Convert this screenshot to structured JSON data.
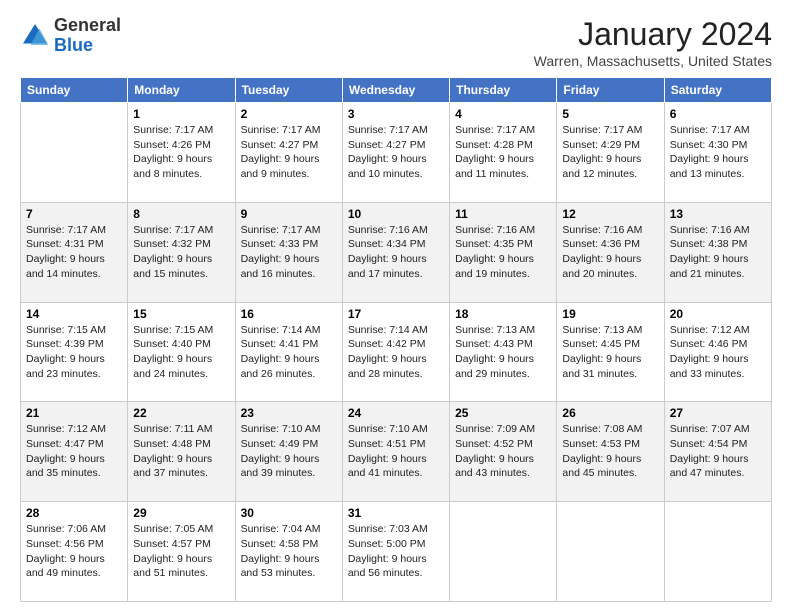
{
  "header": {
    "logo_general": "General",
    "logo_blue": "Blue",
    "month_title": "January 2024",
    "location": "Warren, Massachusetts, United States"
  },
  "weekdays": [
    "Sunday",
    "Monday",
    "Tuesday",
    "Wednesday",
    "Thursday",
    "Friday",
    "Saturday"
  ],
  "weeks": [
    [
      {
        "day": "",
        "sunrise": "",
        "sunset": "",
        "daylight": ""
      },
      {
        "day": "1",
        "sunrise": "Sunrise: 7:17 AM",
        "sunset": "Sunset: 4:26 PM",
        "daylight": "Daylight: 9 hours and 8 minutes."
      },
      {
        "day": "2",
        "sunrise": "Sunrise: 7:17 AM",
        "sunset": "Sunset: 4:27 PM",
        "daylight": "Daylight: 9 hours and 9 minutes."
      },
      {
        "day": "3",
        "sunrise": "Sunrise: 7:17 AM",
        "sunset": "Sunset: 4:27 PM",
        "daylight": "Daylight: 9 hours and 10 minutes."
      },
      {
        "day": "4",
        "sunrise": "Sunrise: 7:17 AM",
        "sunset": "Sunset: 4:28 PM",
        "daylight": "Daylight: 9 hours and 11 minutes."
      },
      {
        "day": "5",
        "sunrise": "Sunrise: 7:17 AM",
        "sunset": "Sunset: 4:29 PM",
        "daylight": "Daylight: 9 hours and 12 minutes."
      },
      {
        "day": "6",
        "sunrise": "Sunrise: 7:17 AM",
        "sunset": "Sunset: 4:30 PM",
        "daylight": "Daylight: 9 hours and 13 minutes."
      }
    ],
    [
      {
        "day": "7",
        "sunrise": "Sunrise: 7:17 AM",
        "sunset": "Sunset: 4:31 PM",
        "daylight": "Daylight: 9 hours and 14 minutes."
      },
      {
        "day": "8",
        "sunrise": "Sunrise: 7:17 AM",
        "sunset": "Sunset: 4:32 PM",
        "daylight": "Daylight: 9 hours and 15 minutes."
      },
      {
        "day": "9",
        "sunrise": "Sunrise: 7:17 AM",
        "sunset": "Sunset: 4:33 PM",
        "daylight": "Daylight: 9 hours and 16 minutes."
      },
      {
        "day": "10",
        "sunrise": "Sunrise: 7:16 AM",
        "sunset": "Sunset: 4:34 PM",
        "daylight": "Daylight: 9 hours and 17 minutes."
      },
      {
        "day": "11",
        "sunrise": "Sunrise: 7:16 AM",
        "sunset": "Sunset: 4:35 PM",
        "daylight": "Daylight: 9 hours and 19 minutes."
      },
      {
        "day": "12",
        "sunrise": "Sunrise: 7:16 AM",
        "sunset": "Sunset: 4:36 PM",
        "daylight": "Daylight: 9 hours and 20 minutes."
      },
      {
        "day": "13",
        "sunrise": "Sunrise: 7:16 AM",
        "sunset": "Sunset: 4:38 PM",
        "daylight": "Daylight: 9 hours and 21 minutes."
      }
    ],
    [
      {
        "day": "14",
        "sunrise": "Sunrise: 7:15 AM",
        "sunset": "Sunset: 4:39 PM",
        "daylight": "Daylight: 9 hours and 23 minutes."
      },
      {
        "day": "15",
        "sunrise": "Sunrise: 7:15 AM",
        "sunset": "Sunset: 4:40 PM",
        "daylight": "Daylight: 9 hours and 24 minutes."
      },
      {
        "day": "16",
        "sunrise": "Sunrise: 7:14 AM",
        "sunset": "Sunset: 4:41 PM",
        "daylight": "Daylight: 9 hours and 26 minutes."
      },
      {
        "day": "17",
        "sunrise": "Sunrise: 7:14 AM",
        "sunset": "Sunset: 4:42 PM",
        "daylight": "Daylight: 9 hours and 28 minutes."
      },
      {
        "day": "18",
        "sunrise": "Sunrise: 7:13 AM",
        "sunset": "Sunset: 4:43 PM",
        "daylight": "Daylight: 9 hours and 29 minutes."
      },
      {
        "day": "19",
        "sunrise": "Sunrise: 7:13 AM",
        "sunset": "Sunset: 4:45 PM",
        "daylight": "Daylight: 9 hours and 31 minutes."
      },
      {
        "day": "20",
        "sunrise": "Sunrise: 7:12 AM",
        "sunset": "Sunset: 4:46 PM",
        "daylight": "Daylight: 9 hours and 33 minutes."
      }
    ],
    [
      {
        "day": "21",
        "sunrise": "Sunrise: 7:12 AM",
        "sunset": "Sunset: 4:47 PM",
        "daylight": "Daylight: 9 hours and 35 minutes."
      },
      {
        "day": "22",
        "sunrise": "Sunrise: 7:11 AM",
        "sunset": "Sunset: 4:48 PM",
        "daylight": "Daylight: 9 hours and 37 minutes."
      },
      {
        "day": "23",
        "sunrise": "Sunrise: 7:10 AM",
        "sunset": "Sunset: 4:49 PM",
        "daylight": "Daylight: 9 hours and 39 minutes."
      },
      {
        "day": "24",
        "sunrise": "Sunrise: 7:10 AM",
        "sunset": "Sunset: 4:51 PM",
        "daylight": "Daylight: 9 hours and 41 minutes."
      },
      {
        "day": "25",
        "sunrise": "Sunrise: 7:09 AM",
        "sunset": "Sunset: 4:52 PM",
        "daylight": "Daylight: 9 hours and 43 minutes."
      },
      {
        "day": "26",
        "sunrise": "Sunrise: 7:08 AM",
        "sunset": "Sunset: 4:53 PM",
        "daylight": "Daylight: 9 hours and 45 minutes."
      },
      {
        "day": "27",
        "sunrise": "Sunrise: 7:07 AM",
        "sunset": "Sunset: 4:54 PM",
        "daylight": "Daylight: 9 hours and 47 minutes."
      }
    ],
    [
      {
        "day": "28",
        "sunrise": "Sunrise: 7:06 AM",
        "sunset": "Sunset: 4:56 PM",
        "daylight": "Daylight: 9 hours and 49 minutes."
      },
      {
        "day": "29",
        "sunrise": "Sunrise: 7:05 AM",
        "sunset": "Sunset: 4:57 PM",
        "daylight": "Daylight: 9 hours and 51 minutes."
      },
      {
        "day": "30",
        "sunrise": "Sunrise: 7:04 AM",
        "sunset": "Sunset: 4:58 PM",
        "daylight": "Daylight: 9 hours and 53 minutes."
      },
      {
        "day": "31",
        "sunrise": "Sunrise: 7:03 AM",
        "sunset": "Sunset: 5:00 PM",
        "daylight": "Daylight: 9 hours and 56 minutes."
      },
      {
        "day": "",
        "sunrise": "",
        "sunset": "",
        "daylight": ""
      },
      {
        "day": "",
        "sunrise": "",
        "sunset": "",
        "daylight": ""
      },
      {
        "day": "",
        "sunrise": "",
        "sunset": "",
        "daylight": ""
      }
    ]
  ]
}
